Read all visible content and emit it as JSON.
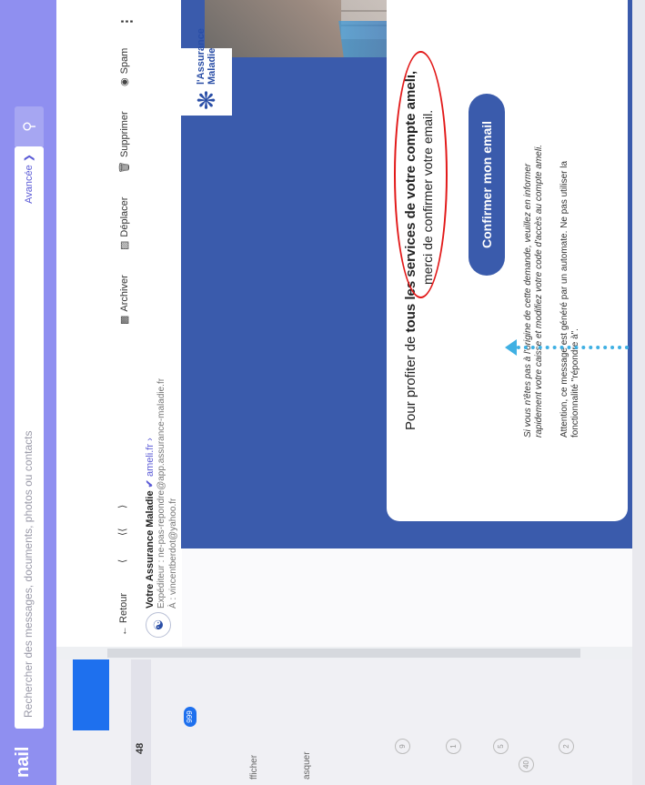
{
  "app": {
    "brand": "nail"
  },
  "search": {
    "placeholder": "Rechercher des messages, documents, photos ou contacts",
    "advanced_label": "Avancée ❯",
    "button_icon": "search-icon"
  },
  "sidebar": {
    "inbox_count": "48",
    "badge": "999",
    "labels": [
      "fficher",
      "asquer"
    ],
    "counts": [
      "9",
      "1",
      "5",
      "40",
      "2"
    ]
  },
  "toolbar": {
    "back": "← Retour",
    "archive": "Archiver",
    "move": "Déplacer",
    "delete": "Supprimer",
    "spam": "Spam",
    "more": "⋮"
  },
  "sender": {
    "name": "Votre Assurance Maladie",
    "domain": "ameli.fr ›",
    "expediteur": "Expéditeur : ne-pas-repondre@app.assurance-maladie.fr",
    "to": "À : vincentberdot@yahoo.fr"
  },
  "email": {
    "logo_text_1": "l'Assurance",
    "logo_text_2": "Maladie",
    "headline_1_prefix": "Pour profiter de ",
    "headline_1_bold": "tous les services de votre compte ameli,",
    "headline_2": "merci de confirmer votre email.",
    "confirm_button": "Confirmer mon email",
    "note_1": "Si vous n'êtes pas à l'origine de cette demande, veuillez en informer",
    "note_2": "rapidement votre caisse et modifiez votre code d'accès au compte ameli.",
    "note_3": "Attention, ce message est généré par un automate. Ne pas utiliser la",
    "note_4": "fonctionnalité \"répondre à\"."
  },
  "colors": {
    "accent": "#3a5bac",
    "topbar": "#8f8ff0",
    "highlight": "#e21919",
    "arrow": "#3fb0e3"
  }
}
